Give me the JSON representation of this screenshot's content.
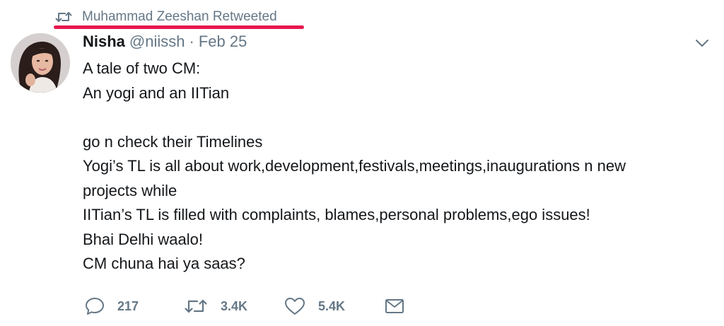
{
  "retweet_context": {
    "label": "Muhammad Zeeshan Retweeted",
    "icon": "retweet-icon",
    "highlight_color": "#e8184f"
  },
  "author": {
    "name": "Nisha",
    "handle": "@niissh",
    "separator": "·",
    "date": "Feb 25"
  },
  "tweet": {
    "lines": [
      "A tale of two CM:",
      "An yogi and an IITian",
      "",
      "go n check their Timelines",
      "Yogi’s TL is all about work,development,festivals,meetings,inaugurations n new",
      "projects while",
      "IITian’s TL is filled with complaints, blames,personal problems,ego issues!",
      "Bhai Delhi waalo!",
      "CM chuna hai ya saas?"
    ]
  },
  "actions": {
    "reply": {
      "icon": "reply-icon",
      "count": "217"
    },
    "retweet": {
      "icon": "retweet-icon",
      "count": "3.4K"
    },
    "like": {
      "icon": "heart-icon",
      "count": "5.4K"
    },
    "dm": {
      "icon": "envelope-icon"
    }
  },
  "menu": {
    "icon": "chevron-down-icon"
  },
  "colors": {
    "text": "#14171a",
    "secondary": "#657786"
  }
}
